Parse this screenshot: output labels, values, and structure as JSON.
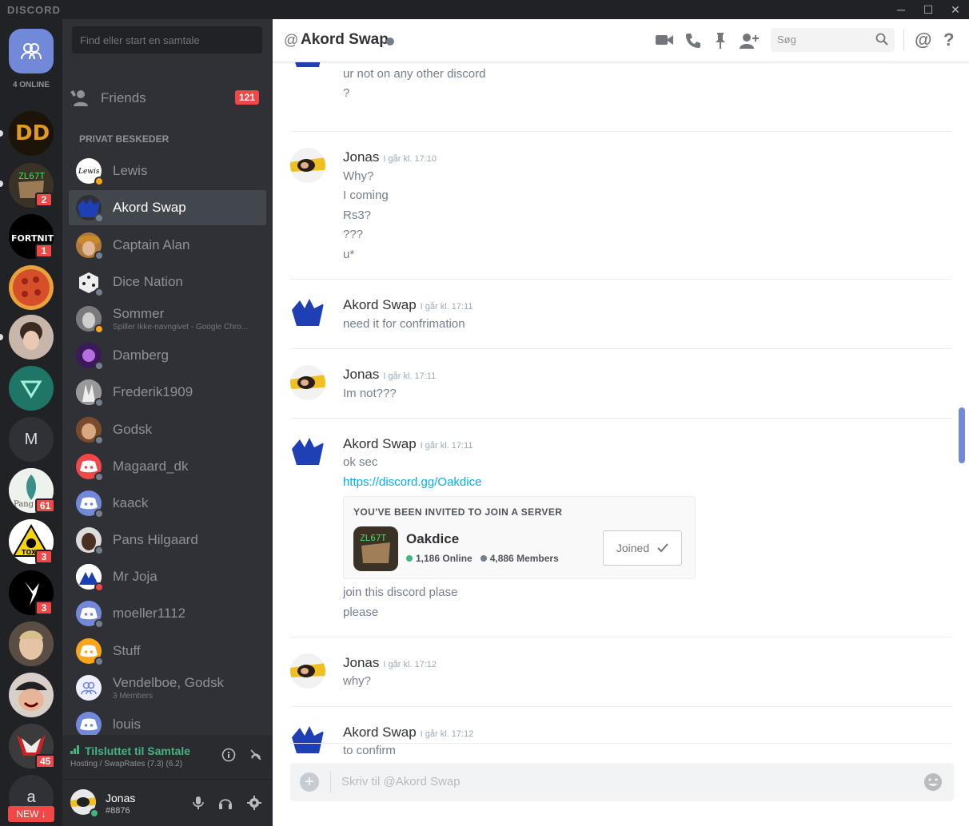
{
  "app": {
    "brand": "DISCORD"
  },
  "guilds": {
    "online_count": "4 ONLINE",
    "badges": [
      "2",
      "1",
      "61",
      "3",
      "3",
      "45"
    ],
    "letters": [
      "M",
      "a"
    ],
    "new_pill": "NEW ↓"
  },
  "sidebar": {
    "search_placeholder": "Find eller start en samtale",
    "friends_label": "Friends",
    "friends_badge": "121",
    "dm_header": "PRIVAT BESKEDER",
    "dms": [
      {
        "name": "Lewis",
        "status": "idle"
      },
      {
        "name": "Akord Swap",
        "status": "offline"
      },
      {
        "name": "Captain Alan",
        "status": "offline"
      },
      {
        "name": "Dice Nation",
        "status": "offline"
      },
      {
        "name": "Sommer",
        "sub": "Spiller Ikke-navngivet - Google Chro...",
        "status": "idle"
      },
      {
        "name": "Damberg",
        "status": "offline"
      },
      {
        "name": "Frederik1909",
        "status": "offline"
      },
      {
        "name": "Godsk",
        "status": "offline"
      },
      {
        "name": "Magaard_dk",
        "status": "offline"
      },
      {
        "name": "kaack",
        "status": "offline"
      },
      {
        "name": "Pans Hilgaard",
        "status": "offline"
      },
      {
        "name": "Mr Joja",
        "status": "dnd"
      },
      {
        "name": "moeller1112",
        "status": "offline"
      },
      {
        "name": "Stuff",
        "status": "offline"
      },
      {
        "name": "Vendelboe, Godsk",
        "sub": "3 Members"
      },
      {
        "name": "louis"
      }
    ],
    "voice": {
      "title": "Tilsluttet til Samtale",
      "sub": "Hosting / SwapRates (7.3) (6.2)"
    },
    "user": {
      "name": "Jonas",
      "tag": "#8876"
    }
  },
  "header": {
    "at": "@",
    "title": "Akord Swap",
    "search_placeholder": "Søg",
    "mention": "@",
    "help": "?"
  },
  "messages": {
    "g0": {
      "lines": [
        "ur not on any other discord",
        "?"
      ]
    },
    "g1": {
      "author": "Jonas",
      "time": "I går kl. 17:10",
      "lines": [
        "Why?",
        "I coming",
        "Rs3?",
        "???",
        "u*"
      ]
    },
    "g2": {
      "author": "Akord Swap",
      "time": "I går kl. 17:11",
      "lines": [
        "need it for confrimation"
      ]
    },
    "g3": {
      "author": "Jonas",
      "time": "I går kl. 17:11",
      "lines": [
        "Im not???"
      ]
    },
    "g4": {
      "author": "Akord Swap",
      "time": "I går kl. 17:11",
      "lines": [
        "ok sec",
        "https://discord.gg/Oakdice",
        "join this discord plase",
        "please"
      ]
    },
    "g5": {
      "author": "Jonas",
      "time": "I går kl. 17:12",
      "lines": [
        "why?"
      ]
    },
    "g6": {
      "author": "Akord Swap",
      "time": "I går kl. 17:12",
      "lines": [
        "to confirm"
      ]
    }
  },
  "invite": {
    "title": "YOU'VE BEEN INVITED TO JOIN A SERVER",
    "server": "Oakdice",
    "online": "1,186 Online",
    "members": "4,886 Members",
    "button": "Joined"
  },
  "composer": {
    "placeholder": "Skriv til @Akord Swap"
  }
}
